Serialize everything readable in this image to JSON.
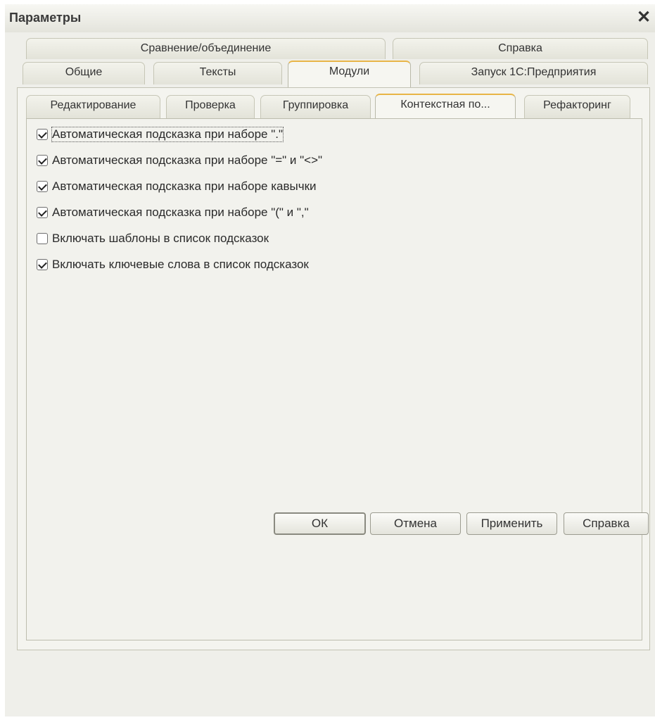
{
  "window": {
    "title": "Параметры",
    "close_label": "✕"
  },
  "tabs_top_row": [
    "Сравнение/объединение",
    "Справка"
  ],
  "tabs_bottom_row": [
    "Общие",
    "Тексты",
    "Модули",
    "Запуск 1С:Предприятия"
  ],
  "active_main_tab": "Модули",
  "subtabs": [
    "Редактирование",
    "Проверка",
    "Группировка",
    "Контекстная по...",
    "Рефакторинг"
  ],
  "active_subtab": "Контекстная по...",
  "options": [
    {
      "label": "Автоматическая подсказка при наборе \".\"",
      "checked": true
    },
    {
      "label": "Автоматическая подсказка при наборе \"=\" и \"<>\"",
      "checked": true
    },
    {
      "label": "Автоматическая подсказка при наборе кавычки",
      "checked": true
    },
    {
      "label": "Автоматическая подсказка при наборе \"(\" и \",\"",
      "checked": true
    },
    {
      "label": "Включать шаблоны в список подсказок",
      "checked": false
    },
    {
      "label": "Включать ключевые слова в список подсказок",
      "checked": true
    }
  ],
  "buttons": {
    "ok": "ОК",
    "cancel": "Отмена",
    "apply": "Применить",
    "help": "Справка"
  }
}
